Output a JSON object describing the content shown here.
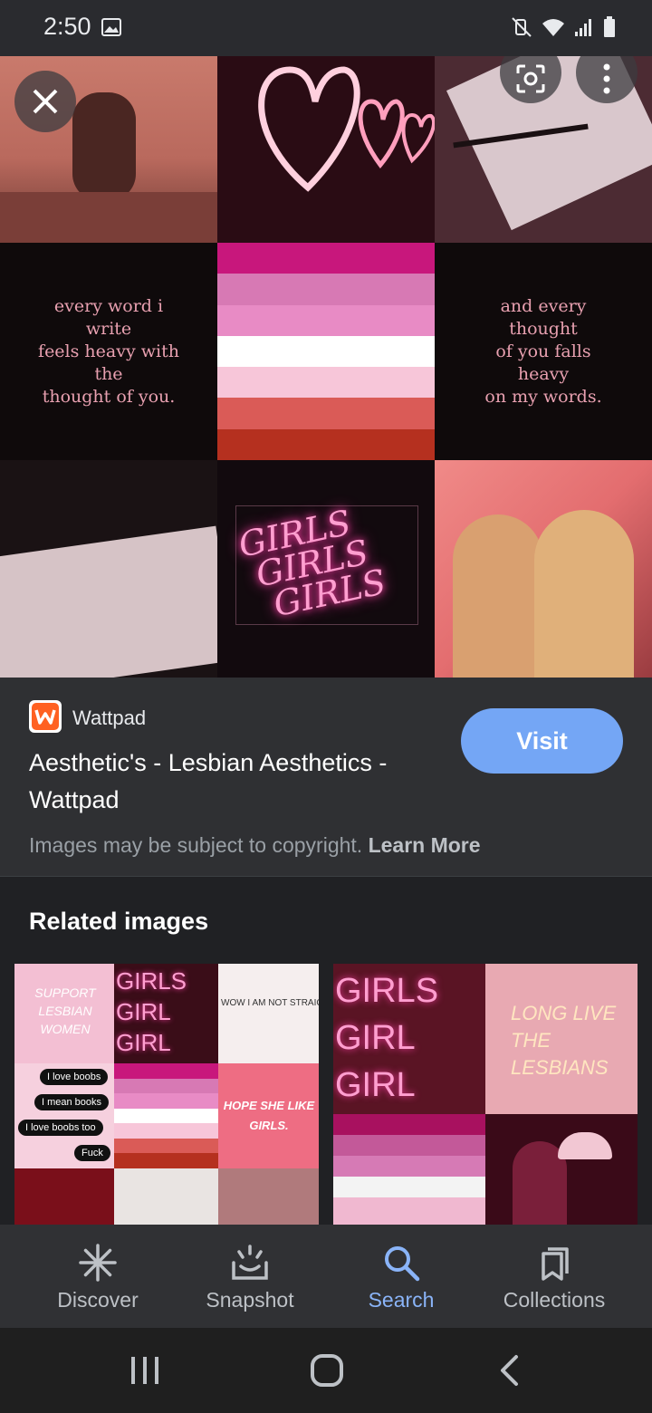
{
  "status_bar": {
    "time": "2:50",
    "icons": [
      "image-icon",
      "mute-icon",
      "wifi-icon",
      "signal-icon",
      "battery-icon"
    ]
  },
  "hero": {
    "quote_left": "every word i write\nfeels heavy with the\nthought of you.",
    "quote_right": "and every thought\nof you falls heavy\non my words.",
    "neon_sign": "GIRLS\n GIRLS\n  GIRLS"
  },
  "result": {
    "source": "Wattpad",
    "title": "Aesthetic's - Lesbian Aesthetics - Wattpad",
    "visit_label": "Visit",
    "copyright_text": "Images may be subject to copyright.",
    "learn_more": "Learn More"
  },
  "related": {
    "heading": "Related images",
    "thumb1": {
      "support_text": "SUPPORT\nLESBIAN\nWOMEN",
      "bubbles": [
        "I love boobs",
        "I mean books",
        "I love boobs too",
        "Fuck"
      ],
      "girls_sign": "GIRLS\nGIRL\nGIRL",
      "wow_text": "WOW I AM NOT STRAIGH",
      "hope_text": "HOPE SHE LIKE\nGIRLS."
    },
    "thumb2": {
      "girls_sign": "GIRLS\nGIRL\nGIRL",
      "long_live": "LONG LIVE\nTHE LESBIANS"
    }
  },
  "bottom_nav": {
    "items": [
      {
        "label": "Discover",
        "icon": "asterisk-icon",
        "active": false
      },
      {
        "label": "Snapshot",
        "icon": "snapshot-icon",
        "active": false
      },
      {
        "label": "Search",
        "icon": "search-icon",
        "active": true
      },
      {
        "label": "Collections",
        "icon": "collections-icon",
        "active": false
      }
    ]
  },
  "colors": {
    "accent": "#8ab4f8",
    "visit_button": "#74a6f5",
    "background": "#202124"
  }
}
